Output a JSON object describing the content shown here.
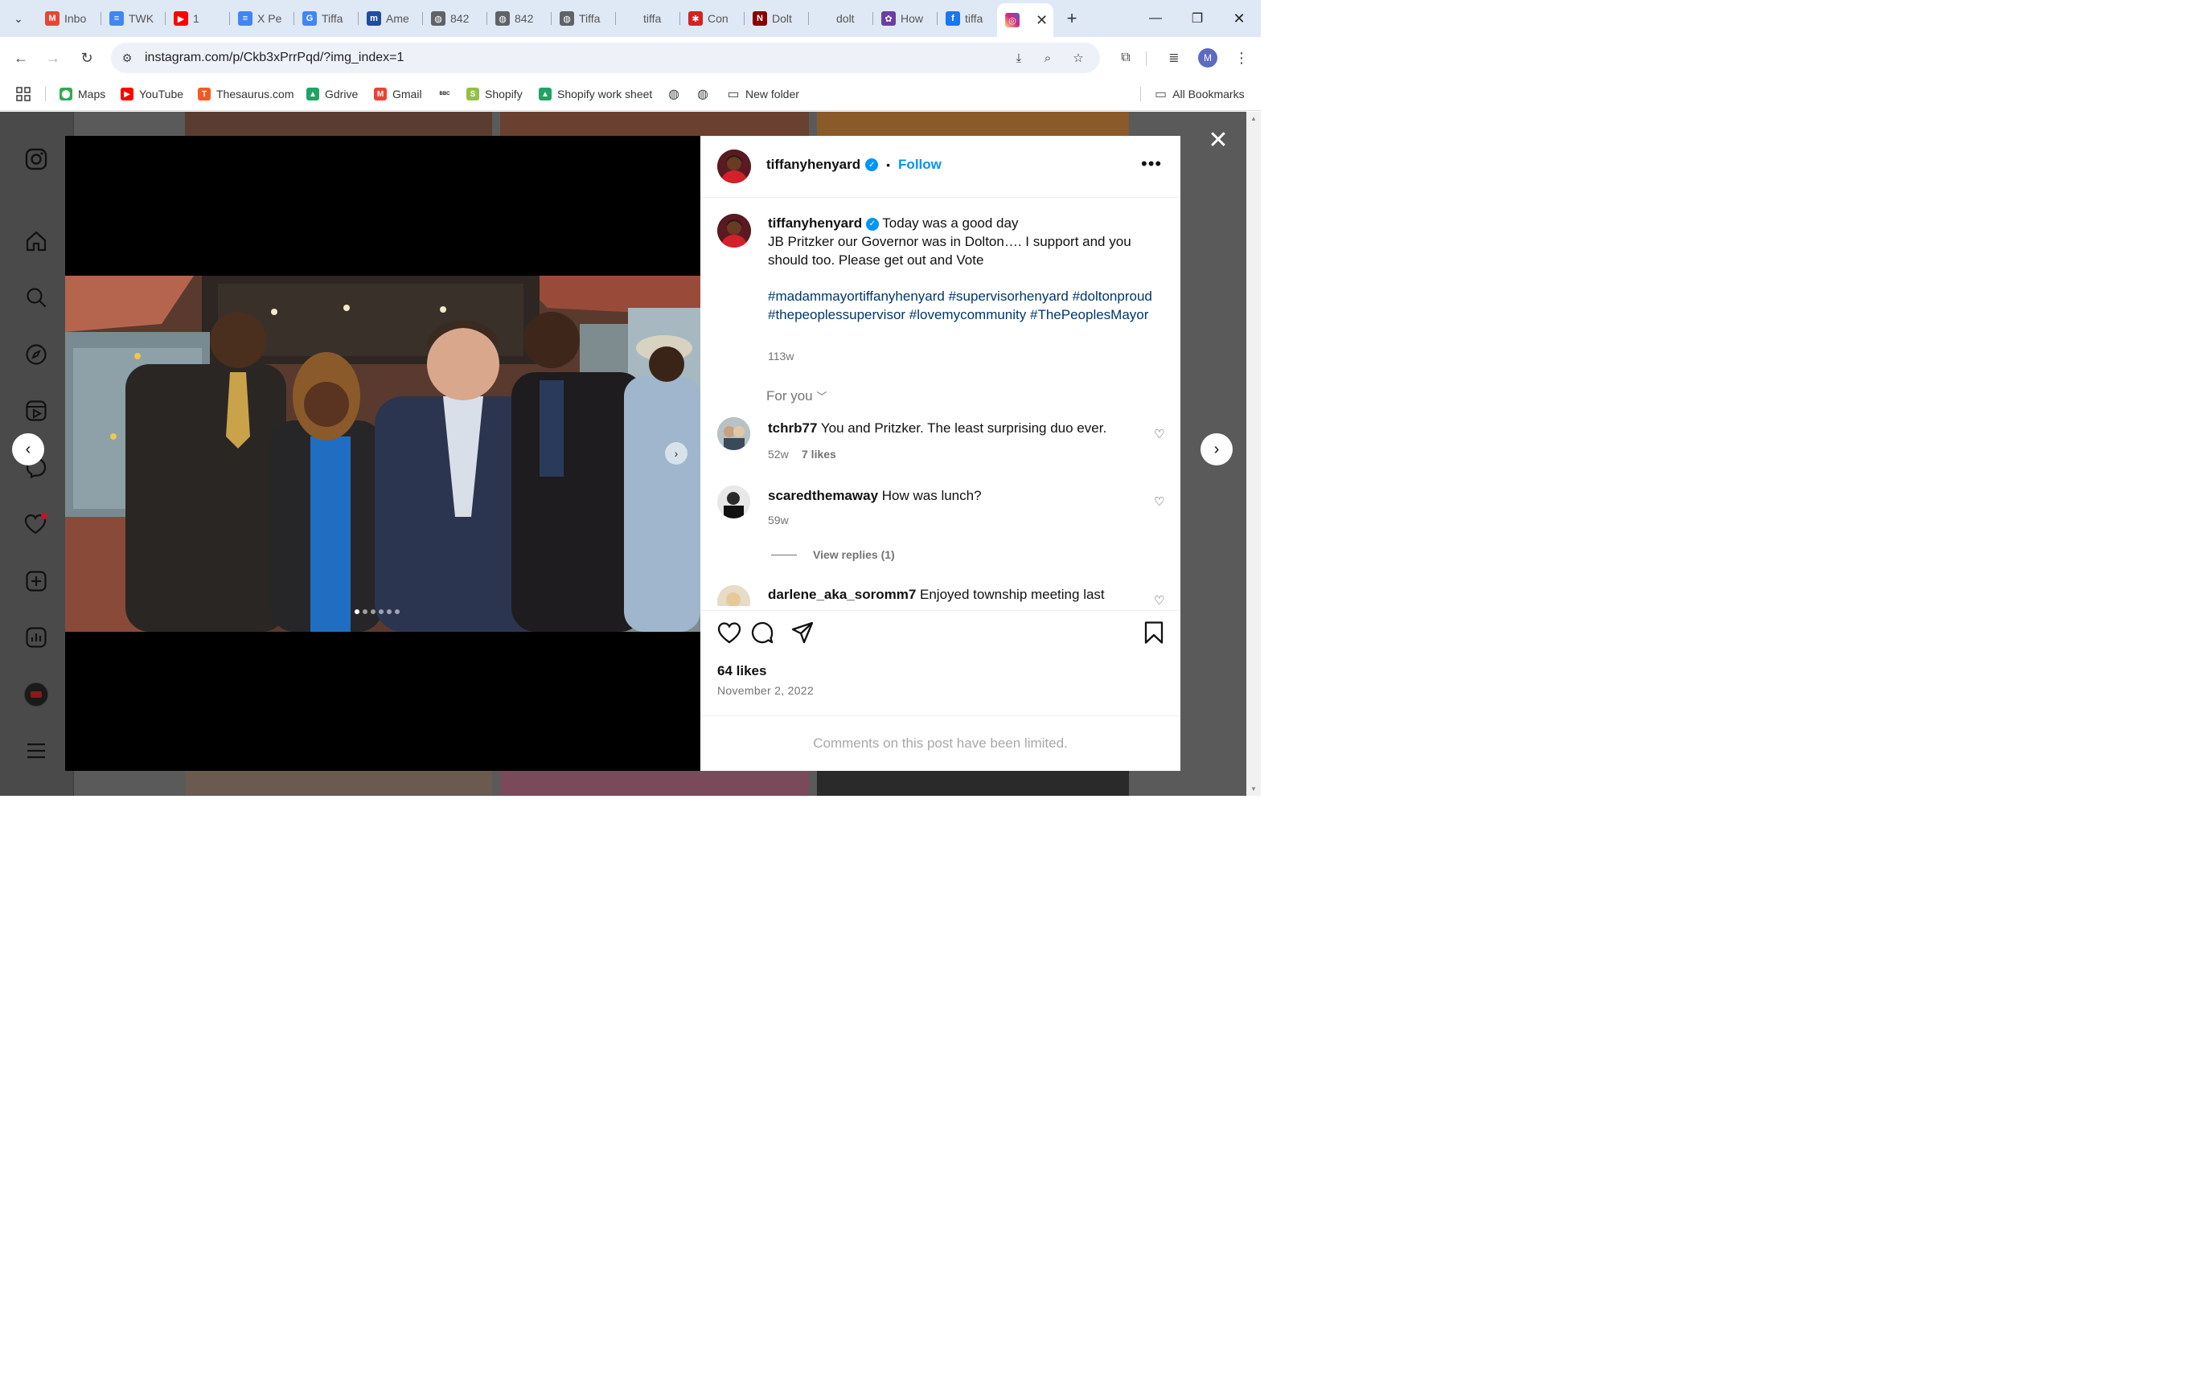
{
  "tabs": [
    {
      "label": "Inbo",
      "icon": "gmail-icon",
      "color": "#ea4335",
      "glyph": "M"
    },
    {
      "label": "TWK",
      "icon": "docs-icon",
      "color": "#4285f4",
      "glyph": "≡"
    },
    {
      "label": "1",
      "icon": "youtube-icon",
      "color": "#ff0000",
      "glyph": "▶"
    },
    {
      "label": "X Pe",
      "icon": "docs-icon",
      "color": "#4285f4",
      "glyph": "≡"
    },
    {
      "label": "Tiffa",
      "icon": "google-icon",
      "color": "#4285f4",
      "glyph": "G"
    },
    {
      "label": "Ame",
      "icon": "merriam-icon",
      "color": "#1f4e9c",
      "glyph": "m"
    },
    {
      "label": "842",
      "icon": "globe-icon",
      "color": "#5f6368",
      "glyph": "◍"
    },
    {
      "label": "842",
      "icon": "globe-icon",
      "color": "#5f6368",
      "glyph": "◍"
    },
    {
      "label": "Tiffa",
      "icon": "globe-icon",
      "color": "#5f6368",
      "glyph": "◍"
    },
    {
      "label": "tiffa",
      "icon": "",
      "color": "#ffffff",
      "glyph": ""
    },
    {
      "label": "Con",
      "icon": "yelp-icon",
      "color": "#d32323",
      "glyph": "✱"
    },
    {
      "label": "Dolt",
      "icon": "news-icon",
      "color": "#8b0000",
      "glyph": "N"
    },
    {
      "label": "dolt",
      "icon": "",
      "color": "#ffffff",
      "glyph": ""
    },
    {
      "label": "How",
      "icon": "nbc-icon",
      "color": "#6a3fa0",
      "glyph": "✿"
    },
    {
      "label": "tiffa",
      "icon": "facebook-icon",
      "color": "#1877f2",
      "glyph": "f"
    }
  ],
  "active_tab": {
    "icon": "instagram-icon",
    "color": "#e1306c"
  },
  "address": {
    "url": "instagram.com/p/Ckb3xPrrPqd/?img_index=1"
  },
  "profile_initial": "M",
  "bookmarks": [
    {
      "label": "Maps",
      "icon": "maps-pin-icon",
      "color": "#34a853",
      "glyph": "⬤"
    },
    {
      "label": "YouTube",
      "icon": "youtube-icon",
      "color": "#ff0000",
      "glyph": "▶"
    },
    {
      "label": "Thesaurus.com",
      "icon": "thesaurus-icon",
      "color": "#f15a24",
      "glyph": "T"
    },
    {
      "label": "Gdrive",
      "icon": "drive-icon",
      "color": "#1fa463",
      "glyph": "▲"
    },
    {
      "label": "Gmail",
      "icon": "gmail-icon",
      "color": "#ea4335",
      "glyph": "M"
    },
    {
      "label": "",
      "icon": "bbc-icon",
      "color": "#222222",
      "glyph": "BBC"
    },
    {
      "label": "Shopify",
      "icon": "shopify-icon",
      "color": "#95bf47",
      "glyph": "S"
    },
    {
      "label": "Shopify work sheet",
      "icon": "drive-icon",
      "color": "#1fa463",
      "glyph": "▲"
    },
    {
      "label": "",
      "icon": "globe-icon",
      "color": "#555555",
      "glyph": "◍"
    },
    {
      "label": "",
      "icon": "globe-icon",
      "color": "#555555",
      "glyph": "◍"
    },
    {
      "label": "New folder",
      "icon": "folder-icon",
      "color": "#555555",
      "glyph": "▭"
    }
  ],
  "all_bookmarks": "All Bookmarks",
  "post": {
    "username": "tiffanyhenyard",
    "follow": "Follow",
    "caption_title": "Today was a good day",
    "caption_body": "JB Pritzker our Governor was in Dolton…. I support and you should too. Please get out and Vote",
    "hashtags": "#madammayortiffanyhenyard #supervisorhenyard #doltonproud #thepeoplessupervisor #lovemycommunity #ThePeoplesMayor",
    "caption_age": "113w",
    "for_you": "For you",
    "likes": "64 likes",
    "date": "November 2, 2022",
    "comments_limited": "Comments on this post have been limited.",
    "photo_index": 0,
    "photo_count": 6
  },
  "comments": [
    {
      "user": "tchrb77",
      "text": "You and Pritzker. The least surprising duo ever.",
      "age": "52w",
      "likes": "7 likes"
    },
    {
      "user": "scaredthemaway",
      "text": "How was lunch?",
      "age": "59w",
      "likes": "",
      "replies": "View replies (1)"
    },
    {
      "user": "darlene_aka_soromm7",
      "text": "Enjoyed township meeting last",
      "age": "",
      "likes": ""
    }
  ],
  "colors": {
    "accent": "#0095f6",
    "hashtag": "#00376b",
    "muted": "#737373"
  }
}
